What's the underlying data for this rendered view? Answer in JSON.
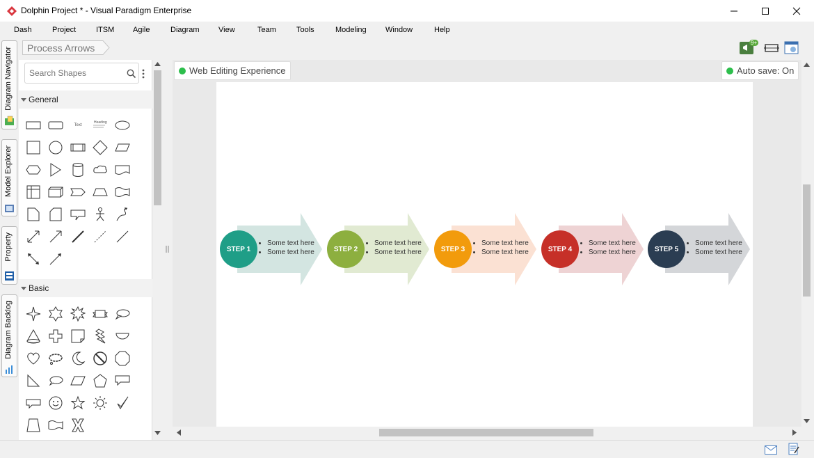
{
  "window": {
    "title": "Dolphin Project * - Visual Paradigm Enterprise"
  },
  "menu": [
    "Dash",
    "Project",
    "ITSM",
    "Agile",
    "Diagram",
    "View",
    "Team",
    "Tools",
    "Modeling",
    "Window",
    "Help"
  ],
  "side_tabs": [
    "Diagram Navigator",
    "Model Explorer",
    "Property",
    "Diagram Backlog"
  ],
  "breadcrumb": "Process Arrows",
  "search": {
    "placeholder": "Search Shapes"
  },
  "categories": {
    "general": "General",
    "basic": "Basic"
  },
  "shape_text": {
    "text": "Text",
    "heading": "Heading"
  },
  "toolbar": {
    "notification_badge": "9+"
  },
  "chips": {
    "web_editing": "Web Editing Experience",
    "auto_save": "Auto save: On"
  },
  "colors": {
    "status_green": "#2dbe4c",
    "accent_red": "#d9363e"
  },
  "steps": [
    {
      "label": "STEP 1",
      "bullets": [
        "Some text here",
        "Some text here"
      ],
      "circle": "#1f9e87",
      "arrow": "#d3e5e1"
    },
    {
      "label": "STEP 2",
      "bullets": [
        "Some text here",
        "Some text here"
      ],
      "circle": "#8daf3f",
      "arrow": "#e1ead2"
    },
    {
      "label": "STEP 3",
      "bullets": [
        "Some text here",
        "Some text here"
      ],
      "circle": "#f29b0c",
      "arrow": "#fbe1d3"
    },
    {
      "label": "STEP 4",
      "bullets": [
        "Some text here",
        "Some text here"
      ],
      "circle": "#c63028",
      "arrow": "#eed3d4"
    },
    {
      "label": "STEP 5",
      "bullets": [
        "Some text here",
        "Some text here"
      ],
      "circle": "#2b3d52",
      "arrow": "#d4d6d9"
    }
  ]
}
